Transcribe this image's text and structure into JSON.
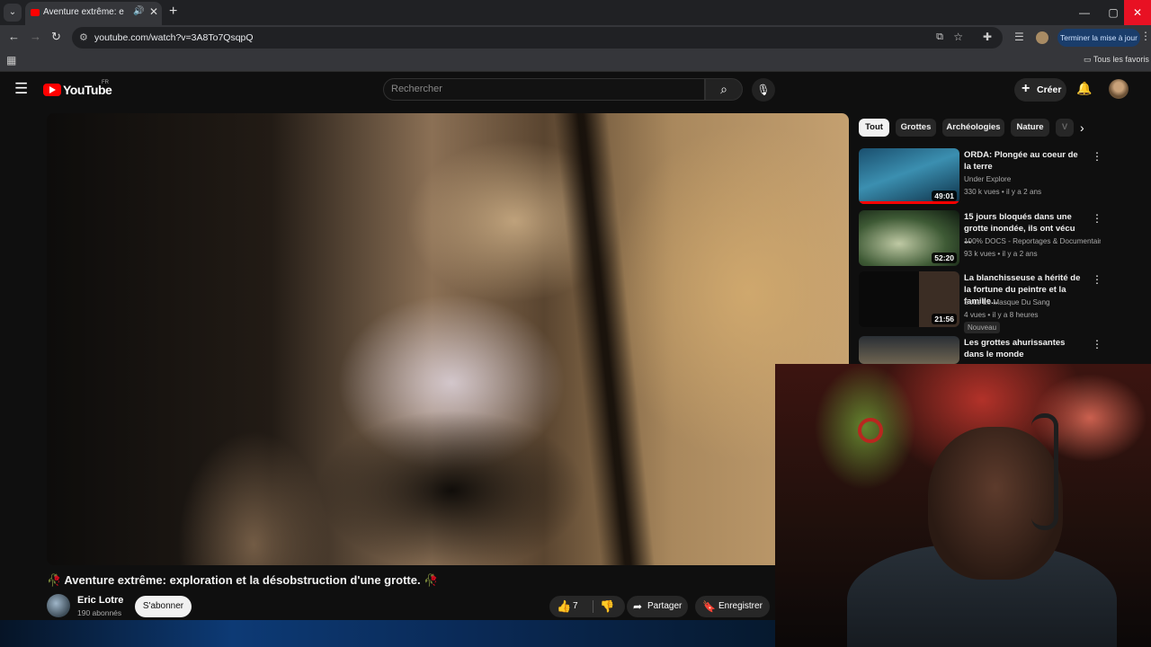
{
  "browser": {
    "tab_title": "Aventure extrême: expl",
    "tab_audio": "🔊",
    "tab_close": "✕",
    "new_tab": "+",
    "url": "youtube.com/watch?v=3A8To7QsqpQ",
    "update_button": "Terminer la mise à jour",
    "bookmarks_folder": "Tous les favoris",
    "window_controls": {
      "minimize": "—",
      "maximize": "▢",
      "close": "✕"
    }
  },
  "header": {
    "logo_text": "YouTube",
    "country": "FR",
    "search_placeholder": "Rechercher",
    "create_label": "Créer"
  },
  "video": {
    "title": "🥀 Aventure extrême: exploration et la désobstruction d'une grotte. 🥀",
    "channel": {
      "name": "Eric Lotre",
      "subscribers": "190 abonnés"
    },
    "subscribe_label": "S'abonner",
    "like_count": "7",
    "share_label": "Partager",
    "save_label": "Enregistrer"
  },
  "chips": [
    "Tout",
    "Grottes",
    "Archéologies",
    "Nature",
    "V"
  ],
  "recommendations": [
    {
      "title": "ORDA: Plongée au coeur de la terre",
      "channel": "Under Explore",
      "stats": "330 k vues • il y a 2 ans",
      "duration": "49:01"
    },
    {
      "title": "15 jours bloqués dans une grotte inondée, ils ont vécu ...",
      "channel": "100% DOCS - Reportages & Documentair...",
      "stats": "93 k vues • il y a 2 ans",
      "duration": "52:20"
    },
    {
      "title": "La blanchisseuse a hérité de la fortune du peintre et la famille...",
      "channel": "Sous Le Masque Du Sang",
      "stats": "4 vues • il y a 8 heures",
      "duration": "21:56",
      "badge": "Nouveau"
    },
    {
      "title": "Les grottes ahurissantes dans le monde",
      "channel": "",
      "stats": "",
      "duration": ""
    }
  ],
  "icons": {
    "menu": "menu-icon",
    "search": "search-icon",
    "mic": "mic-icon",
    "bell": "bell-icon",
    "like": "thumbs-up-icon",
    "dislike": "thumbs-down-icon",
    "share": "share-icon",
    "save": "bookmark-icon"
  },
  "colors": {
    "brand_red": "#ff0000",
    "background": "#0f0f0f",
    "chip_active": "#f1f1f1"
  }
}
